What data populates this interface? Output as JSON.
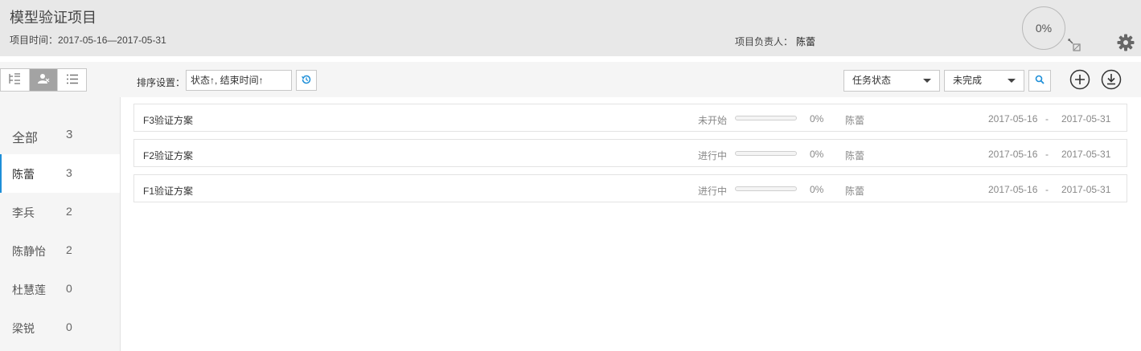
{
  "header": {
    "title": "模型验证项目",
    "time_label": "项目时间：",
    "time_range": "2017-05-16—2017-05-31",
    "owner_label": "项目负责人：",
    "owner_name": "陈蕾",
    "progress_text": "0%",
    "icons": [
      "resize-icon",
      "gear-icon"
    ]
  },
  "toolbar": {
    "view_buttons": [
      "tree-view-icon",
      "member-view-icon",
      "list-view-icon"
    ],
    "active_view": "member-view-icon",
    "sort_label": "排序设置：",
    "sort_value": "状态↑, 结束时间↑",
    "status_filter": "任务状态",
    "completion_filter": "未完成"
  },
  "sidebar": {
    "items": [
      {
        "name": "全部",
        "count": "3"
      },
      {
        "name": "陈蕾",
        "count": "3"
      },
      {
        "name": "李兵",
        "count": "2"
      },
      {
        "name": "陈静怡",
        "count": "2"
      },
      {
        "name": "杜慧莲",
        "count": "0"
      },
      {
        "name": "梁锐",
        "count": "0"
      }
    ],
    "active_index": 1
  },
  "tasks": [
    {
      "name": "F3验证方案",
      "status": "未开始",
      "progress": 0,
      "percent": "0%",
      "owner": "陈蕾",
      "start": "2017-05-16",
      "sep": "-",
      "end": "2017-05-31"
    },
    {
      "name": "F2验证方案",
      "status": "进行中",
      "progress": 0,
      "percent": "0%",
      "owner": "陈蕾",
      "start": "2017-05-16",
      "sep": "-",
      "end": "2017-05-31"
    },
    {
      "name": "F1验证方案",
      "status": "进行中",
      "progress": 0,
      "percent": "0%",
      "owner": "陈蕾",
      "start": "2017-05-16",
      "sep": "-",
      "end": "2017-05-31"
    }
  ],
  "colors": {
    "accent": "#1e8fd8",
    "header_bg": "#e8e8e8",
    "sidebar_bg": "#f5f5f5",
    "active_view_bg": "#a3a3a3"
  }
}
